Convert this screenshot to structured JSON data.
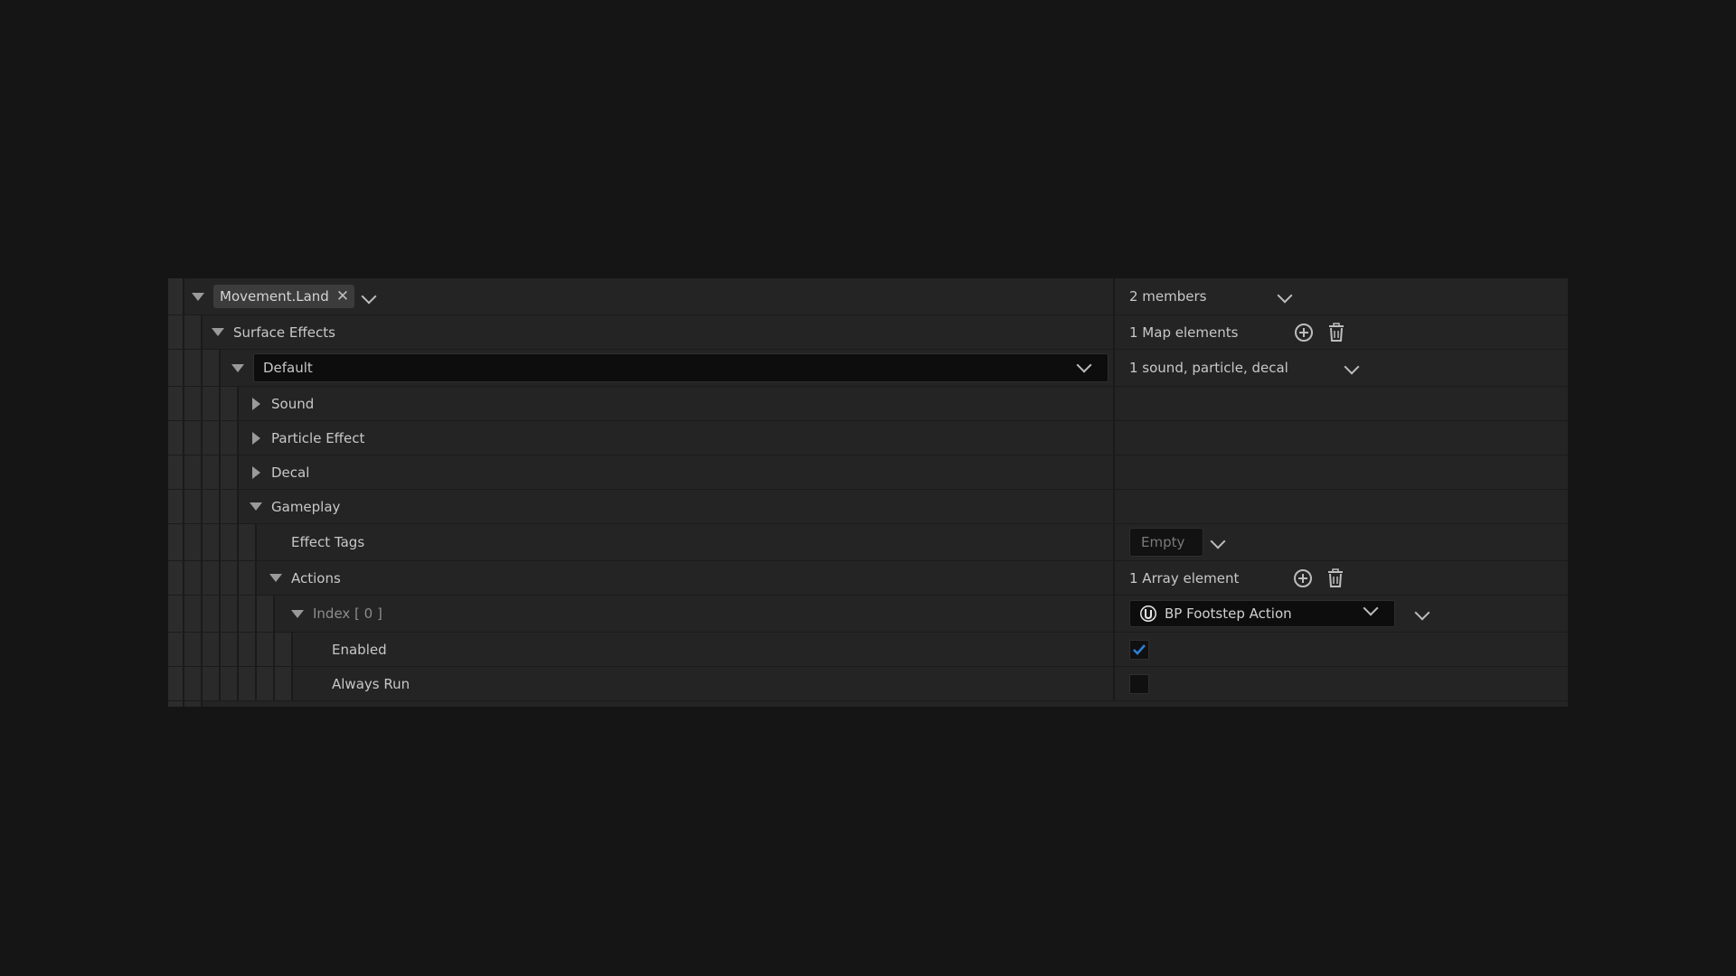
{
  "rows": {
    "movement": {
      "tag": "Movement.Land",
      "value": "2 members"
    },
    "surface_effects": {
      "label": "Surface Effects",
      "value": "1 Map elements"
    },
    "default": {
      "label": "Default",
      "value": "1 sound, particle, decal"
    },
    "sound": {
      "label": "Sound"
    },
    "particle": {
      "label": "Particle Effect"
    },
    "decal": {
      "label": "Decal"
    },
    "gameplay": {
      "label": "Gameplay"
    },
    "effect_tags": {
      "label": "Effect Tags",
      "value": "Empty"
    },
    "actions": {
      "label": "Actions",
      "value": "1 Array element"
    },
    "index0": {
      "label": "Index [ 0 ]",
      "value": "BP Footstep Action"
    },
    "enabled": {
      "label": "Enabled",
      "checked": true
    },
    "always_run": {
      "label": "Always Run",
      "checked": false
    }
  },
  "colors": {
    "accent": "#2f7fd8",
    "panel": "#242424",
    "background": "#151515"
  }
}
